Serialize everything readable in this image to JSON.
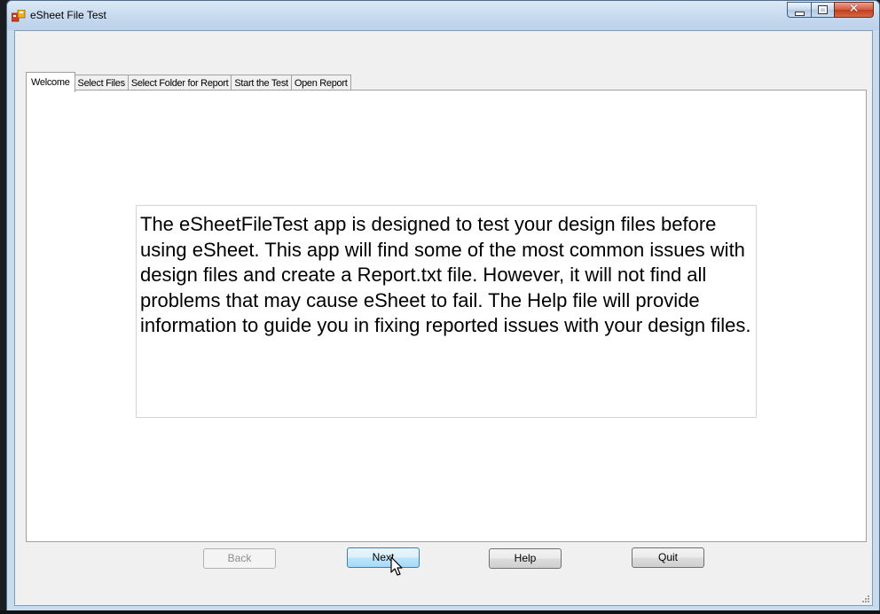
{
  "window": {
    "title": "eSheet File Test",
    "close_glyph": "✕"
  },
  "tabs": [
    {
      "label": "Welcome",
      "active": true
    },
    {
      "label": "Select Files",
      "active": false
    },
    {
      "label": "Select Folder for Report",
      "active": false
    },
    {
      "label": "Start the Test",
      "active": false
    },
    {
      "label": "Open Report",
      "active": false
    }
  ],
  "welcome": {
    "text": "The eSheetFileTest app is designed to test your design files before using eSheet. This app will find some of the most common issues with design files and create a Report.txt file. However, it will not find all problems that may cause eSheet to fail. The Help file will provide information to guide you in fixing reported issues with your design files."
  },
  "buttons": {
    "back": {
      "label": "Back",
      "enabled": false
    },
    "next": {
      "label": "Next",
      "enabled": true
    },
    "help": {
      "label": "Help",
      "enabled": true
    },
    "quit": {
      "label": "Quit",
      "enabled": true
    }
  },
  "icons": {
    "app": "app-icon",
    "cursor": "mouse-cursor-icon"
  }
}
